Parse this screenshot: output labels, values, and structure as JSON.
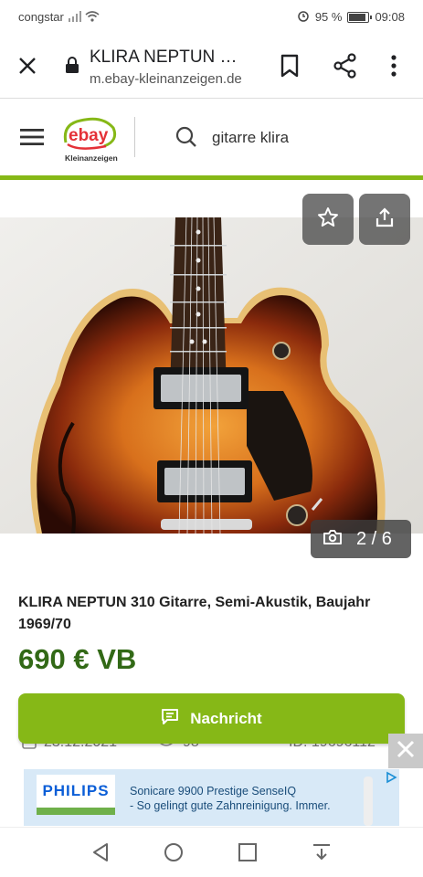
{
  "status_bar": {
    "carrier": "congstar",
    "battery": "95 %",
    "time": "09:08",
    "battery_level": 0.95
  },
  "browser": {
    "title": "KLIRA NEPTUN …",
    "url": "m.ebay-kleinanzeigen.de"
  },
  "header": {
    "logo_top": "ebay",
    "logo_bottom": "Kleinanzeigen",
    "search_query": "gitarre klira"
  },
  "gallery": {
    "counter": "2 / 6"
  },
  "ad": {
    "title": "KLIRA NEPTUN 310 Gitarre, Semi-Akustik, Baujahr 1969/70",
    "price": "690 € VB",
    "message_button": "Nachricht",
    "date": "23.12.2021",
    "views": "98",
    "id": "ID: 19696112"
  },
  "banner": {
    "brand": "PHILIPS",
    "line1": "Sonicare 9900 Prestige SenseIQ",
    "line2": "- So gelingt gute Zahnreinigung. Immer."
  },
  "colors": {
    "accent_green": "#86b817",
    "price_green": "#326916"
  }
}
